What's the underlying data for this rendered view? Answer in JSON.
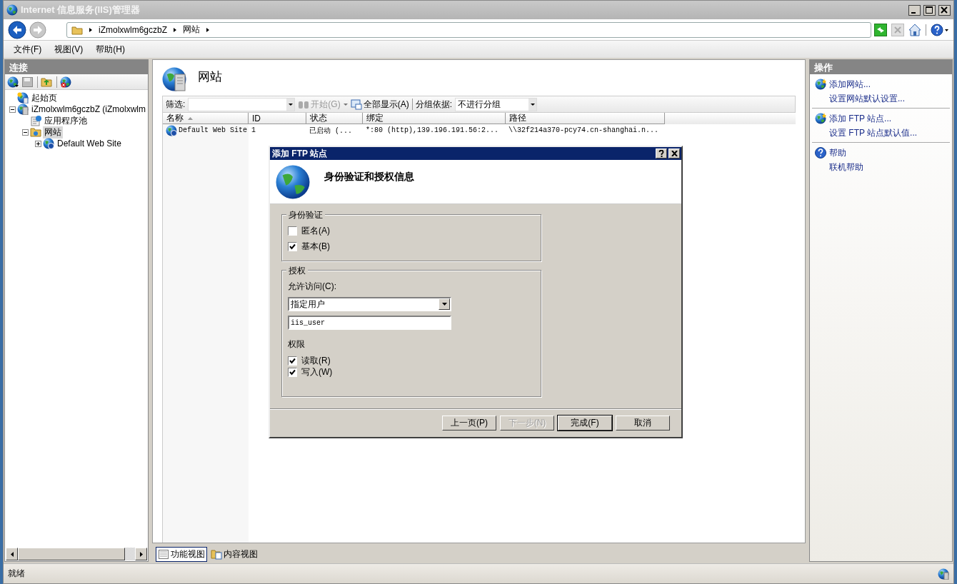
{
  "window": {
    "title": "Internet 信息服务(IIS)管理器"
  },
  "address_bar": {
    "segments": [
      "iZmolxwlm6gczbZ",
      "网站"
    ]
  },
  "menu": [
    "文件(F)",
    "视图(V)",
    "帮助(H)"
  ],
  "connections": {
    "title": "连接",
    "tree": [
      {
        "label": "起始页",
        "kind": "start",
        "selected": false
      },
      {
        "label": "iZmolxwlm6gczbZ (iZmolxwlm",
        "kind": "server",
        "selected": false,
        "expanded": true,
        "children": [
          {
            "label": "应用程序池",
            "kind": "pool",
            "selected": false
          },
          {
            "label": "网站",
            "kind": "sites",
            "selected": true,
            "expanded": true,
            "children": [
              {
                "label": "Default Web Site",
                "kind": "site",
                "selected": false,
                "expanded": false
              }
            ]
          }
        ]
      }
    ]
  },
  "content": {
    "title": "网站",
    "filter": {
      "label": "筛选:",
      "start": {
        "label": "开始(G)",
        "disabled": true
      },
      "show_all": "全部显示(A)",
      "group_label": "分组依据:",
      "group_value": "不进行分组"
    },
    "table": {
      "columns": [
        {
          "label": "名称",
          "sorted": true
        },
        {
          "label": "ID",
          "sorted": false
        },
        {
          "label": "状态",
          "sorted": false
        },
        {
          "label": "绑定",
          "sorted": false
        },
        {
          "label": "路径",
          "sorted": false
        }
      ],
      "rows": [
        {
          "selected": false,
          "cells": [
            "Default Web Site",
            "1",
            "已启动 (...",
            "*:80 (http),139.196.191.56:2...",
            "\\\\32f214a370-pcy74.cn-shanghai.n..."
          ]
        }
      ]
    }
  },
  "view_tabs": [
    {
      "label": "功能视图",
      "selected": true
    },
    {
      "label": "内容视图",
      "selected": false
    }
  ],
  "actions": {
    "title": "操作",
    "groups": [
      {
        "items": [
          {
            "label": "添加网站...",
            "kind": "add"
          },
          {
            "label": "设置网站默认设置...",
            "kind": "plain"
          }
        ]
      },
      {
        "items": [
          {
            "label": "添加 FTP 站点...",
            "kind": "add"
          },
          {
            "label": "设置 FTP 站点默认值...",
            "kind": "plain"
          }
        ]
      },
      {
        "items": [
          {
            "label": "帮助",
            "kind": "help"
          },
          {
            "label": "联机帮助",
            "kind": "plain"
          }
        ]
      }
    ]
  },
  "status_bar": "就绪",
  "dialog": {
    "title": "添加 FTP 站点",
    "heading": "身份验证和授权信息",
    "authentication": {
      "title": "身份验证",
      "options": [
        {
          "label": "匿名(A)",
          "checked": false
        },
        {
          "label": "基本(B)",
          "checked": true
        }
      ]
    },
    "authorization": {
      "title": "授权",
      "access_label": "允许访问(C):",
      "access_value": "指定用户",
      "user_value": "iis_user",
      "permissions_label": "权限",
      "permissions": [
        {
          "label": "读取(R)",
          "checked": true
        },
        {
          "label": "写入(W)",
          "checked": true
        }
      ]
    },
    "buttons": [
      {
        "label": "上一页(P)",
        "disabled": false,
        "default": false
      },
      {
        "label": "下一步(N)",
        "disabled": true,
        "default": false
      },
      {
        "label": "完成(F)",
        "disabled": false,
        "default": true
      },
      {
        "label": "取消",
        "disabled": false,
        "default": false
      }
    ]
  }
}
